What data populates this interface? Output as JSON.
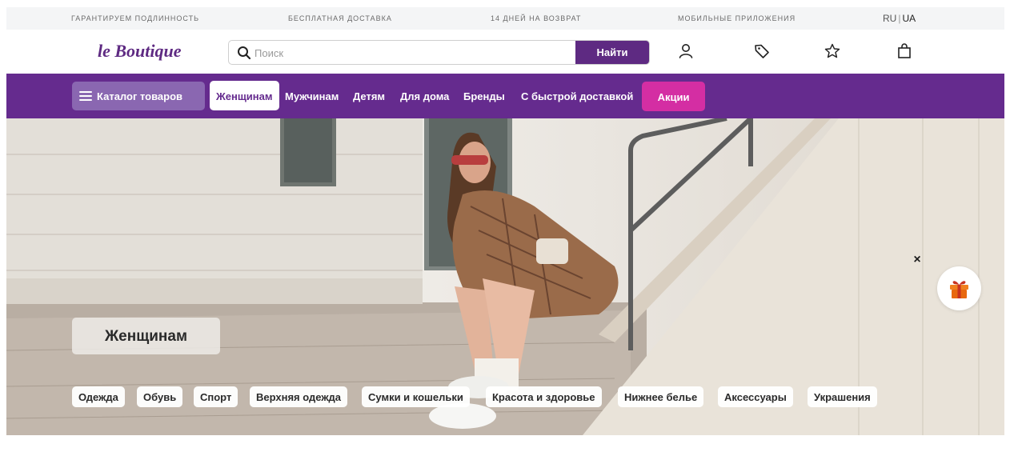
{
  "topbar": {
    "items": [
      "ГАРАНТИРУЕМ ПОДЛИННОСТЬ",
      "БЕСПЛАТНАЯ ДОСТАВКА",
      "14 ДНЕЙ НА ВОЗВРАТ",
      "МОБИЛЬНЫЕ ПРИЛОЖЕНИЯ"
    ],
    "lang_ru": "RU",
    "lang_sep": "|",
    "lang_ua": "UA"
  },
  "header": {
    "logo": "le Boutique",
    "search_placeholder": "Поиск",
    "search_button": "Найти",
    "icons": [
      "user-icon",
      "tag-icon",
      "star-icon",
      "bag-icon"
    ]
  },
  "nav": {
    "catalog": "Каталог товаров",
    "items": [
      "Женщинам",
      "Мужчинам",
      "Детям",
      "Для дома",
      "Бренды",
      "С быстрой доставкой"
    ],
    "active": "Женщинам",
    "promo": "Акции"
  },
  "hero": {
    "title": "Женщинам",
    "categories": [
      "Одежда",
      "Обувь",
      "Спорт",
      "Верхняя одежда",
      "Сумки и кошельки",
      "Красота и здоровье",
      "Нижнее белье",
      "Аксессуары",
      "Украшения"
    ]
  },
  "widgets": {
    "close": "×",
    "gift_icon": "gift-icon"
  },
  "colors": {
    "brand_purple": "#652b8e",
    "logo_purple": "#5e2a82",
    "catalog_button": "#8a67b1",
    "promo_pink": "#d42ea3"
  }
}
